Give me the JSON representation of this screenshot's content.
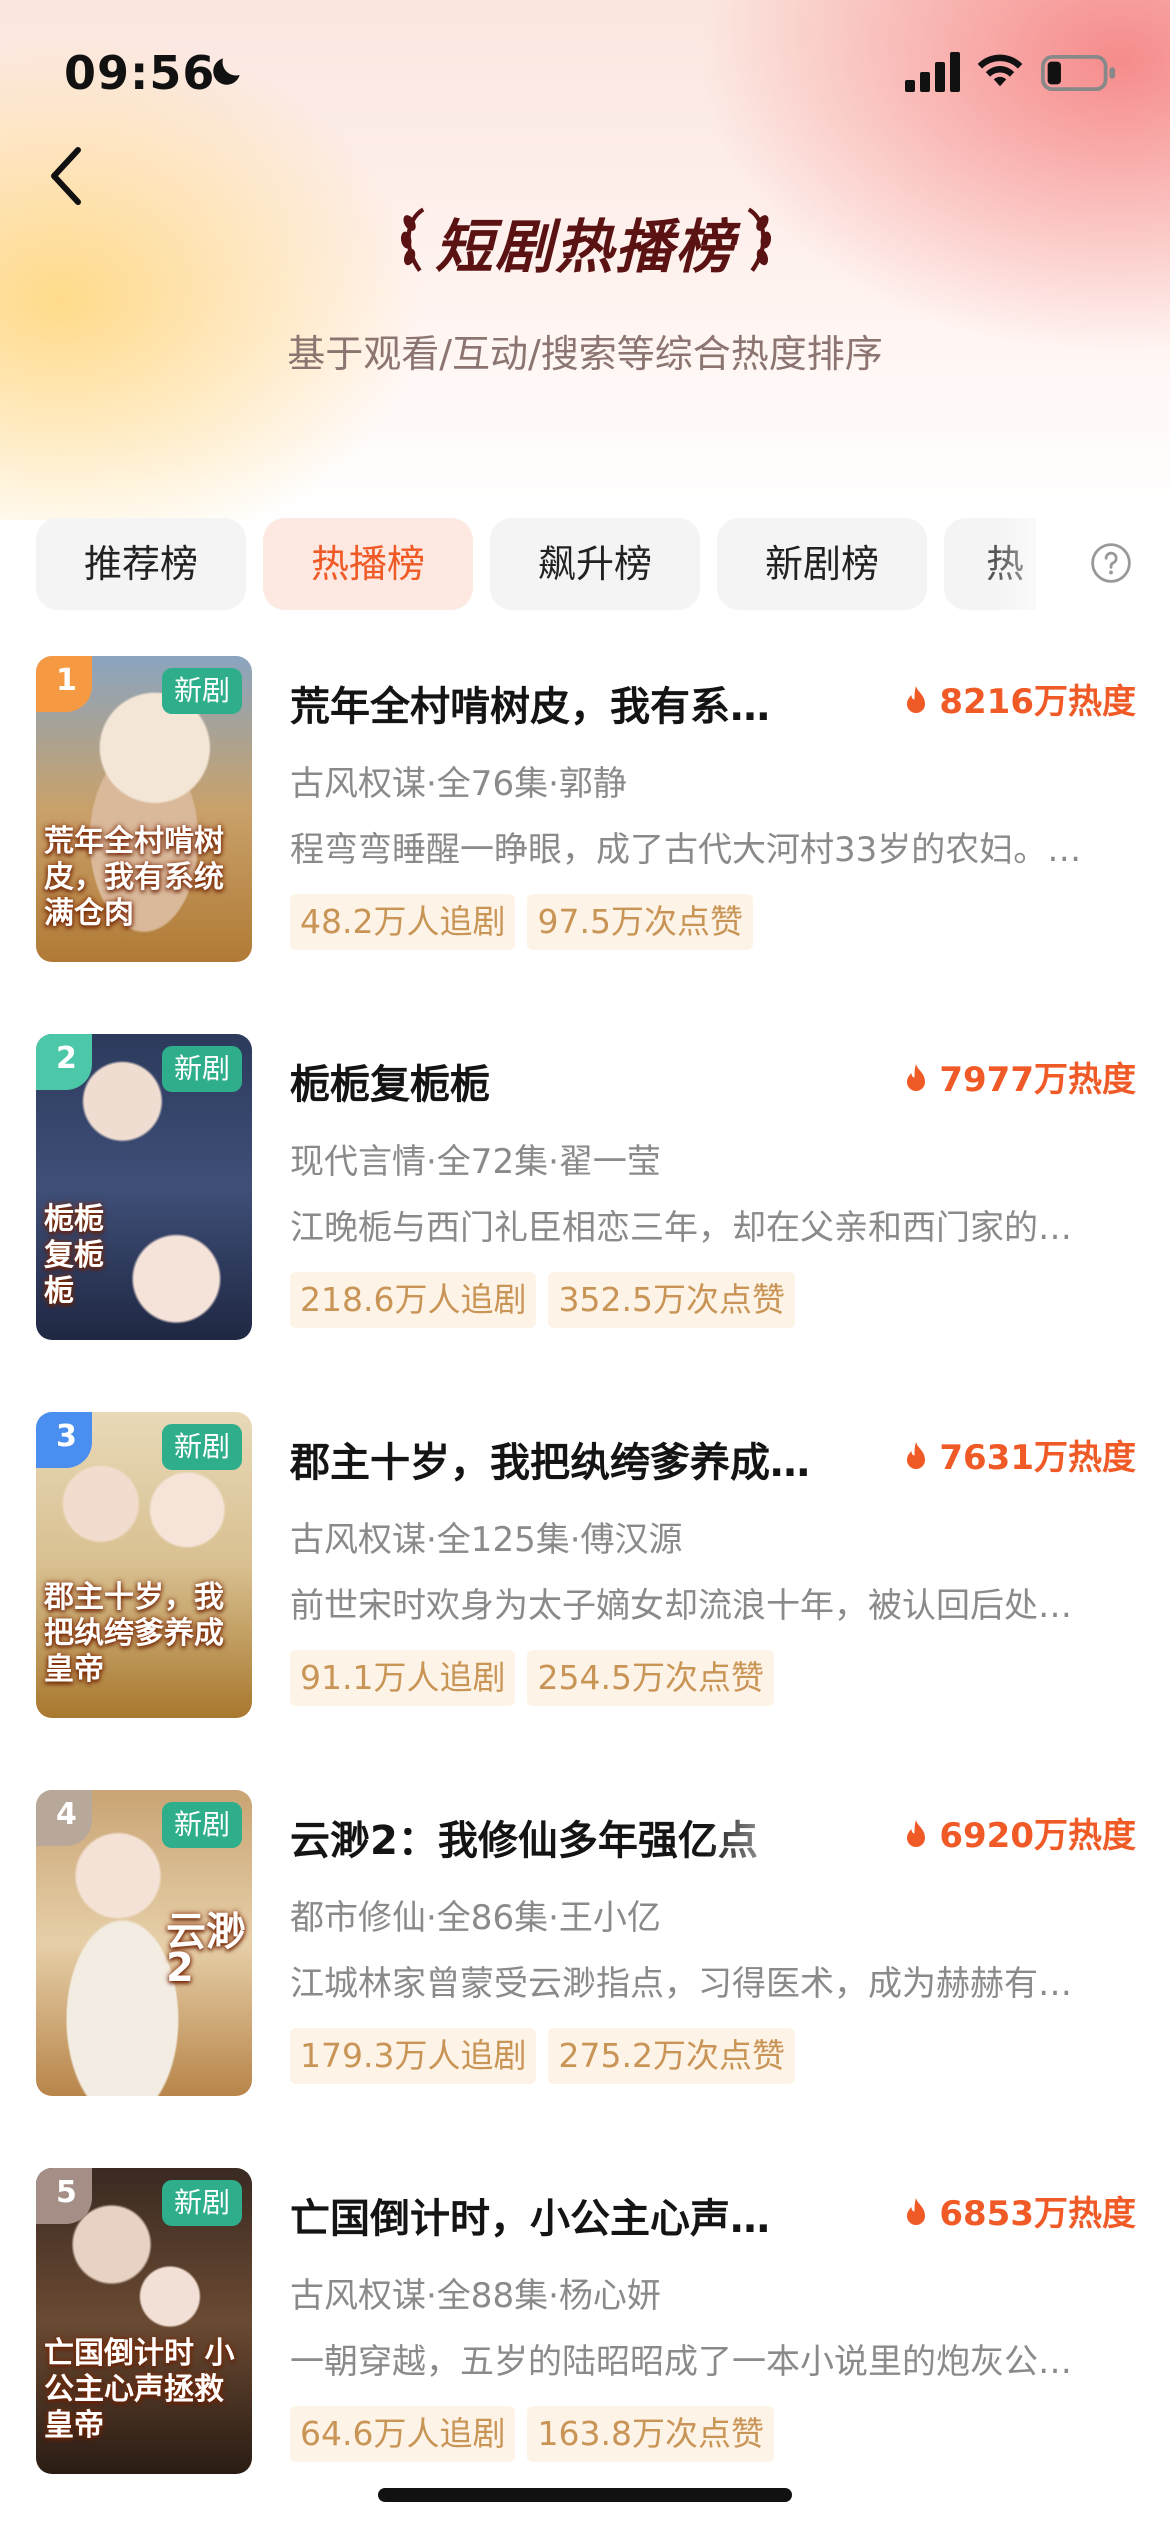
{
  "status_bar": {
    "time": "09:56"
  },
  "header": {
    "title": "短剧热播榜",
    "subtitle": "基于观看/互动/搜索等综合热度排序"
  },
  "tabs": [
    {
      "label": "推荐榜",
      "active": false
    },
    {
      "label": "热播榜",
      "active": true
    },
    {
      "label": "飙升榜",
      "active": false
    },
    {
      "label": "新剧榜",
      "active": false
    },
    {
      "label": "热",
      "active": false
    }
  ],
  "colors": {
    "accent": "#f05a26",
    "badge_green": "#2eae8a",
    "chip_bg": "#fdf3e6",
    "chip_text": "#c99557",
    "title": "#5a1212"
  },
  "items": [
    {
      "rank": "1",
      "rank_color": "#f59a42",
      "badge": "新剧",
      "cover_text": "荒年全村啃树皮，我有系统满仓肉",
      "title": "荒年全村啃树皮，我有系…",
      "heat": "8216万热度",
      "meta": "古风权谋·全76集·郭静",
      "desc": "程弯弯睡醒一睁眼，成了古代大河村33岁的农妇。…",
      "followers": "48.2万人追剧",
      "likes": "97.5万次点赞"
    },
    {
      "rank": "2",
      "rank_color": "#4cc7a8",
      "badge": "新剧",
      "cover_text": "栀栀复栀栀",
      "title": "栀栀复栀栀",
      "heat": "7977万热度",
      "meta": "现代言情·全72集·翟一莹",
      "desc": "江晚栀与西门礼臣相恋三年，却在父亲和西门家的…",
      "followers": "218.6万人追剧",
      "likes": "352.5万次点赞"
    },
    {
      "rank": "3",
      "rank_color": "#4a8ff0",
      "badge": "新剧",
      "cover_text": "郡主十岁，我把纨绔爹养成皇帝",
      "title": "郡主十岁，我把纨绔爹养成…",
      "heat": "7631万热度",
      "meta": "古风权谋·全125集·傅汉源",
      "desc": "前世宋时欢身为太子嫡女却流浪十年，被认回后处…",
      "followers": "91.1万人追剧",
      "likes": "254.5万次点赞"
    },
    {
      "rank": "4",
      "rank_color": "#b8a899",
      "badge": "新剧",
      "cover_text": "云渺2",
      "title": "云渺2：我修仙多年强亿点",
      "heat": "6920万热度",
      "meta": "都市修仙·全86集·王小亿",
      "desc": "江城林家曾蒙受云渺指点，习得医术，成为赫赫有…",
      "followers": "179.3万人追剧",
      "likes": "275.2万次点赞"
    },
    {
      "rank": "5",
      "rank_color": "#a48e86",
      "badge": "新剧",
      "cover_text": "亡国倒计时 小公主心声拯救皇帝",
      "title": "亡国倒计时，小公主心声…",
      "heat": "6853万热度",
      "meta": "古风权谋·全88集·杨心妍",
      "desc": "一朝穿越，五岁的陆昭昭成了一本小说里的炮灰公…",
      "followers": "64.6万人追剧",
      "likes": "163.8万次点赞"
    }
  ]
}
